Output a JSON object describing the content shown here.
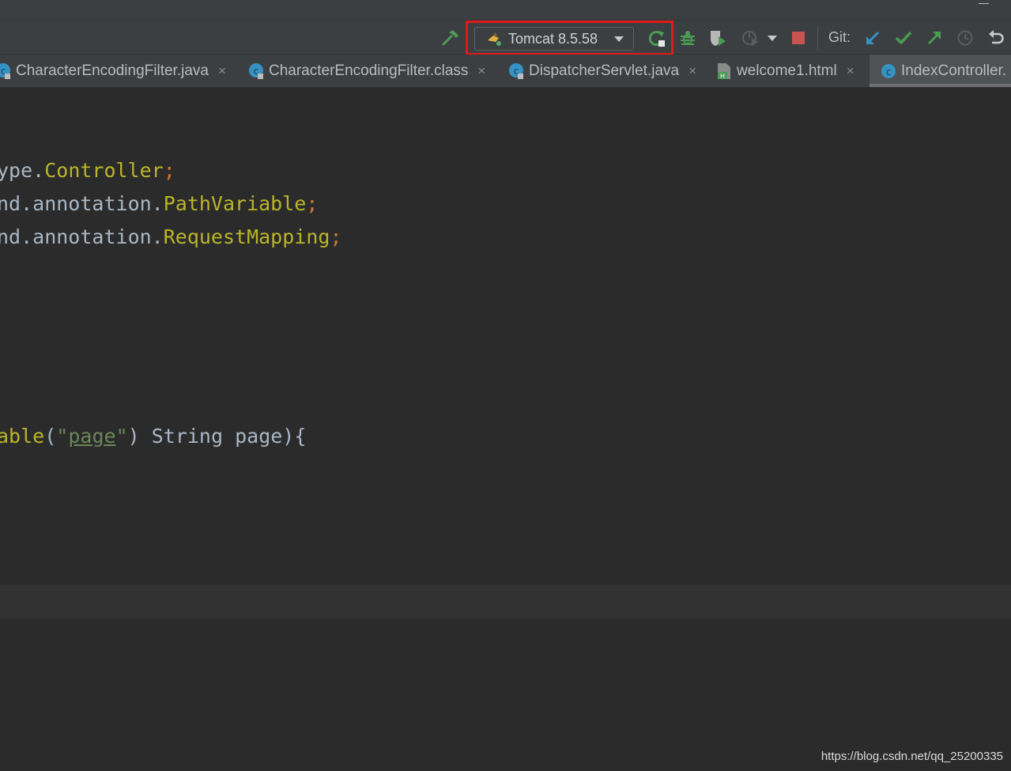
{
  "toolbar": {
    "build_icon": "hammer-icon",
    "run_config": {
      "label": "Tomcat 8.5.58",
      "icon": "tomcat-icon"
    },
    "rerun_icon": "rerun-icon",
    "debug_icon": "debug-bug-icon",
    "coverage_icon": "run-with-coverage-icon",
    "profile_icon": "profile-icon",
    "stop_icon": "stop-icon",
    "git_label": "Git:",
    "git_update_icon": "git-update-arrow-icon",
    "git_commit_icon": "git-commit-check-icon",
    "git_push_icon": "git-push-arrow-icon",
    "history_icon": "history-clock-icon",
    "rollback_icon": "rollback-icon",
    "colors": {
      "highlight": "#e01a1a",
      "green": "#499c54",
      "blue": "#3592c4",
      "red": "#c75450"
    }
  },
  "tabs": [
    {
      "label": "CharacterEncodingFilter.java",
      "icon": "java-class-icon"
    },
    {
      "label": "CharacterEncodingFilter.class",
      "icon": "java-class-icon"
    },
    {
      "label": "DispatcherServlet.java",
      "icon": "java-class-icon"
    },
    {
      "label": "welcome1.html",
      "icon": "html-file-icon"
    },
    {
      "label": "IndexController.",
      "icon": "java-class-icon",
      "active": true
    }
  ],
  "close_glyph": "×",
  "editor": {
    "lines": [
      {
        "pre": "ype.",
        "cls": "Controller",
        "punc": ";"
      },
      {
        "pre": "nd.annotation.",
        "cls": "PathVariable",
        "punc": ";"
      },
      {
        "pre": "nd.annotation.",
        "cls": "RequestMapping",
        "punc": ";"
      }
    ],
    "method_line": {
      "a": "able",
      "b": "(",
      "q1": "\"",
      "str": "page",
      "q2": "\"",
      "c": ") String page){"
    }
  },
  "watermark": "https://blog.csdn.net/qq_25200335"
}
